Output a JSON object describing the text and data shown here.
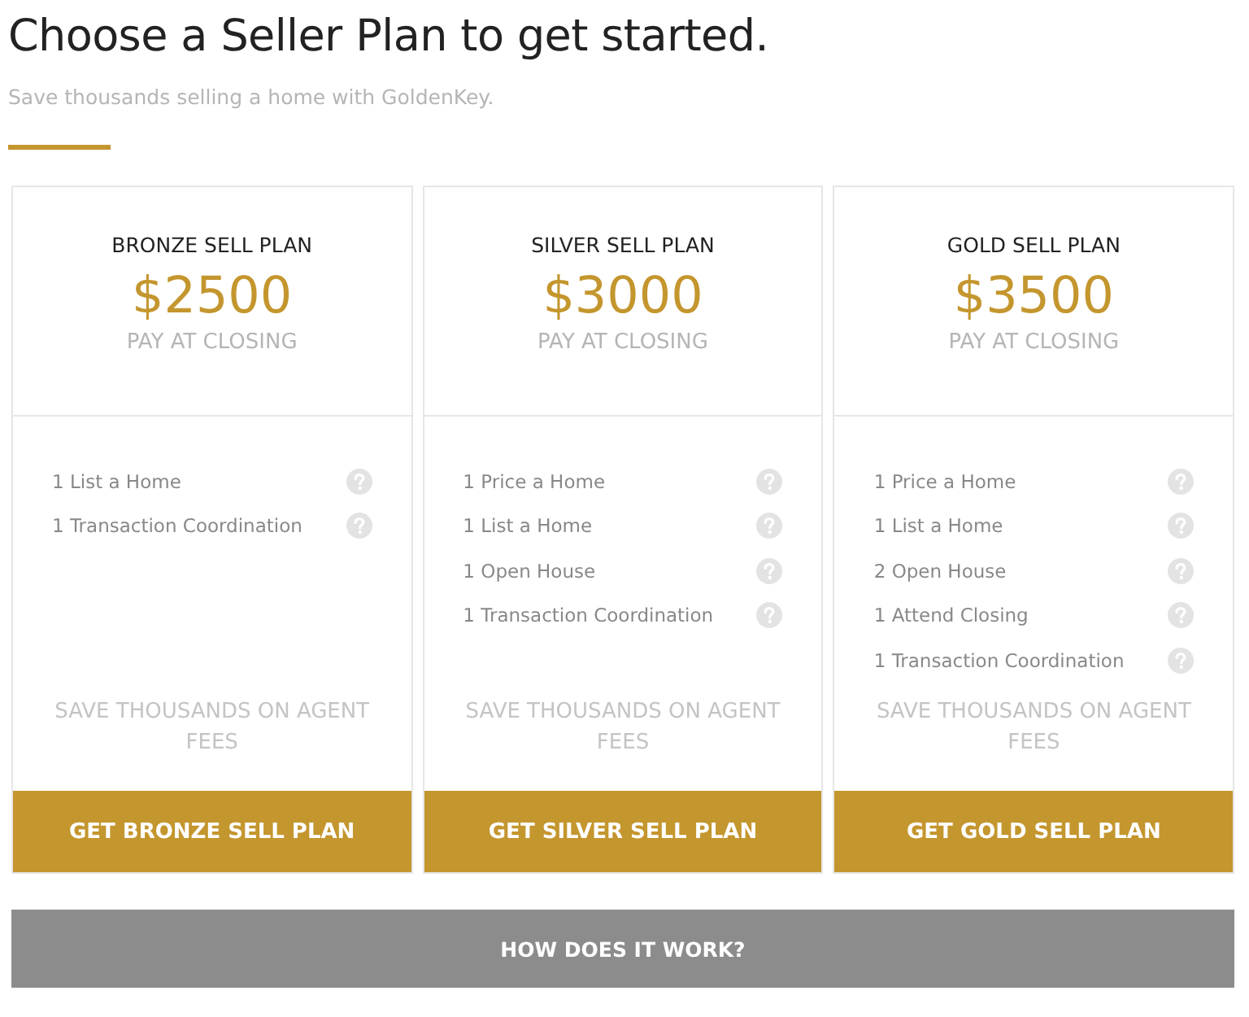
{
  "heading": "Choose a Seller Plan to get started.",
  "subtitle": "Save thousands selling a home with GoldenKey.",
  "plans": [
    {
      "name": "BRONZE SELL PLAN",
      "price": "$2500",
      "price_note": "PAY AT CLOSING",
      "features": [
        "1 List a Home",
        "1 Transaction Coordination"
      ],
      "savings": "SAVE THOUSANDS ON AGENT FEES",
      "button": "GET BRONZE SELL PLAN"
    },
    {
      "name": "SILVER SELL PLAN",
      "price": "$3000",
      "price_note": "PAY AT CLOSING",
      "features": [
        "1 Price a Home",
        "1 List a Home",
        "1 Open House",
        "1 Transaction Coordination"
      ],
      "savings": "SAVE THOUSANDS ON AGENT FEES",
      "button": "GET SILVER SELL PLAN"
    },
    {
      "name": "GOLD SELL PLAN",
      "price": "$3500",
      "price_note": "PAY AT CLOSING",
      "features": [
        "1 Price a Home",
        "1 List a Home",
        "2 Open House",
        "1 Attend Closing",
        "1 Transaction Coordination"
      ],
      "savings": "SAVE THOUSANDS ON AGENT FEES",
      "button": "GET GOLD SELL PLAN"
    }
  ],
  "how_button": "HOW DOES IT WORK?"
}
